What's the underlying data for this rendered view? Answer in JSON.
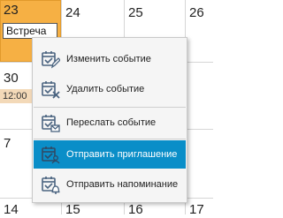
{
  "calendar": {
    "days_row1": [
      "23",
      "24",
      "25",
      "26"
    ],
    "day_row2": "30",
    "days_row3": [
      "7"
    ],
    "days_row4": [
      "14",
      "15",
      "16",
      "17"
    ],
    "selected_event": "Встреча",
    "time_event": "12:00"
  },
  "context_menu": {
    "items": [
      {
        "label": "Изменить событие",
        "icon": "calendar-edit-icon"
      },
      {
        "label": "Удалить событие",
        "icon": "calendar-delete-icon"
      },
      {
        "label": "Переслать событие",
        "icon": "calendar-forward-icon"
      },
      {
        "label": "Отправить приглашение",
        "icon": "calendar-invite-icon"
      },
      {
        "label": "Отправить напоминание",
        "icon": "calendar-reminder-icon"
      }
    ],
    "active_index": 3
  },
  "colors": {
    "selected_cell": "#f6b044",
    "menu_highlight": "#0a8ec8",
    "icon_stroke": "#4b6480",
    "time_chip": "#f3d9b8"
  }
}
